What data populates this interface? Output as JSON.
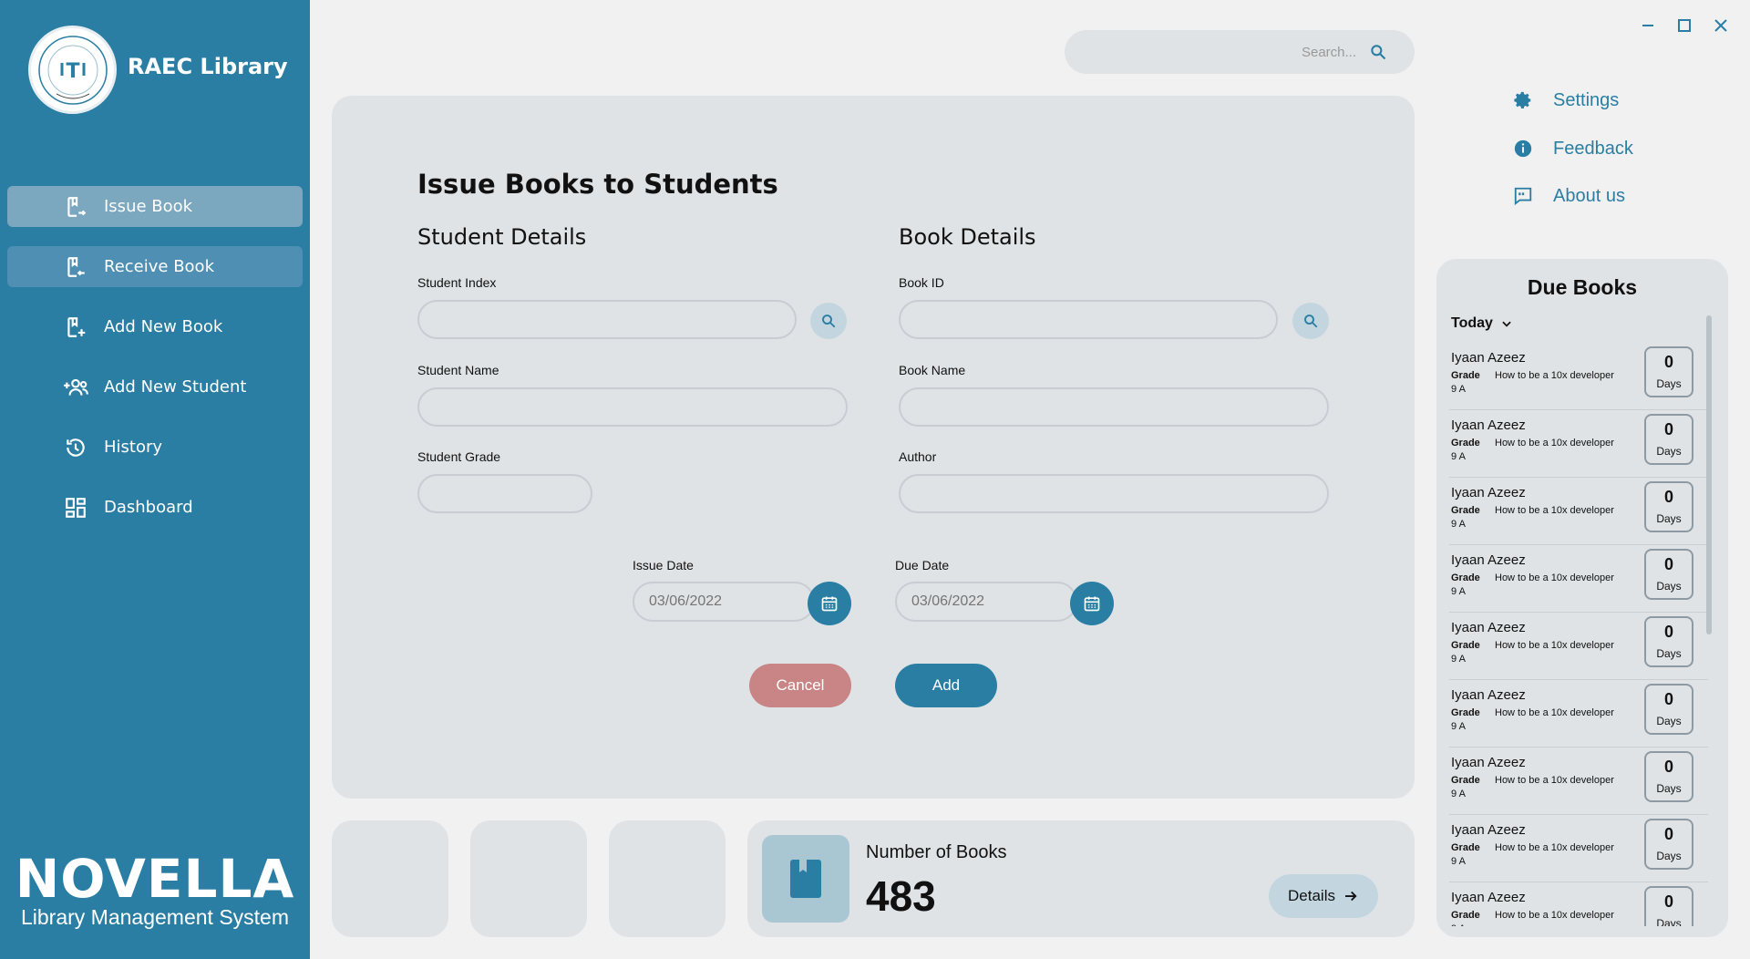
{
  "app": {
    "name": "RAEC Library",
    "brand_title": "NOVELLA",
    "brand_subtitle": "Library Management System",
    "logo_text": "EACH TO SUCCEED"
  },
  "sidebar": {
    "items": [
      {
        "label": "Issue Book",
        "icon": "issue-book-icon"
      },
      {
        "label": "Receive Book",
        "icon": "receive-book-icon"
      },
      {
        "label": "Add New Book",
        "icon": "add-book-icon"
      },
      {
        "label": "Add New Student",
        "icon": "add-student-icon"
      },
      {
        "label": "History",
        "icon": "history-icon"
      },
      {
        "label": "Dashboard",
        "icon": "dashboard-icon"
      }
    ]
  },
  "search": {
    "placeholder": "Search..."
  },
  "right_menu": {
    "settings": "Settings",
    "feedback": "Feedback",
    "about": "About us"
  },
  "form": {
    "title": "Issue Books to Students",
    "student_section": "Student Details",
    "book_section": "Book Details",
    "student_index_label": "Student Index",
    "student_name_label": "Student Name",
    "student_grade_label": "Student Grade",
    "book_id_label": "Book ID",
    "book_name_label": "Book Name",
    "author_label": "Author",
    "issue_date_label": "Issue Date",
    "issue_date_placeholder": "03/06/2022",
    "due_date_label": "Due Date",
    "due_date_placeholder": "03/06/2022",
    "cancel": "Cancel",
    "add": "Add"
  },
  "stats": {
    "books_label": "Number of Books",
    "books_count": "483",
    "details": "Details"
  },
  "due_books": {
    "title": "Due Books",
    "filter": "Today",
    "grade_label": "Grade",
    "days_label": "Days",
    "items": [
      {
        "name": "Iyaan Azeez",
        "book": "How to be a 10x developer",
        "grade": "9 A",
        "days": "0"
      },
      {
        "name": "Iyaan Azeez",
        "book": "How to be a 10x developer",
        "grade": "9 A",
        "days": "0"
      },
      {
        "name": "Iyaan Azeez",
        "book": "How to be a 10x developer",
        "grade": "9 A",
        "days": "0"
      },
      {
        "name": "Iyaan Azeez",
        "book": "How to be a 10x developer",
        "grade": "9 A",
        "days": "0"
      },
      {
        "name": "Iyaan Azeez",
        "book": "How to be a 10x developer",
        "grade": "9 A",
        "days": "0"
      },
      {
        "name": "Iyaan Azeez",
        "book": "How to be a 10x developer",
        "grade": "9 A",
        "days": "0"
      },
      {
        "name": "Iyaan Azeez",
        "book": "How to be a 10x developer",
        "grade": "9 A",
        "days": "0"
      },
      {
        "name": "Iyaan Azeez",
        "book": "How to be a 10x developer",
        "grade": "9 A",
        "days": "0"
      },
      {
        "name": "Iyaan Azeez",
        "book": "How to be a 10x developer",
        "grade": "9 A",
        "days": "0"
      }
    ]
  },
  "colors": {
    "primary": "#2a7ea3",
    "cancel": "#c98585",
    "panel": "#dfe3e6",
    "background": "#f1f1f1"
  }
}
